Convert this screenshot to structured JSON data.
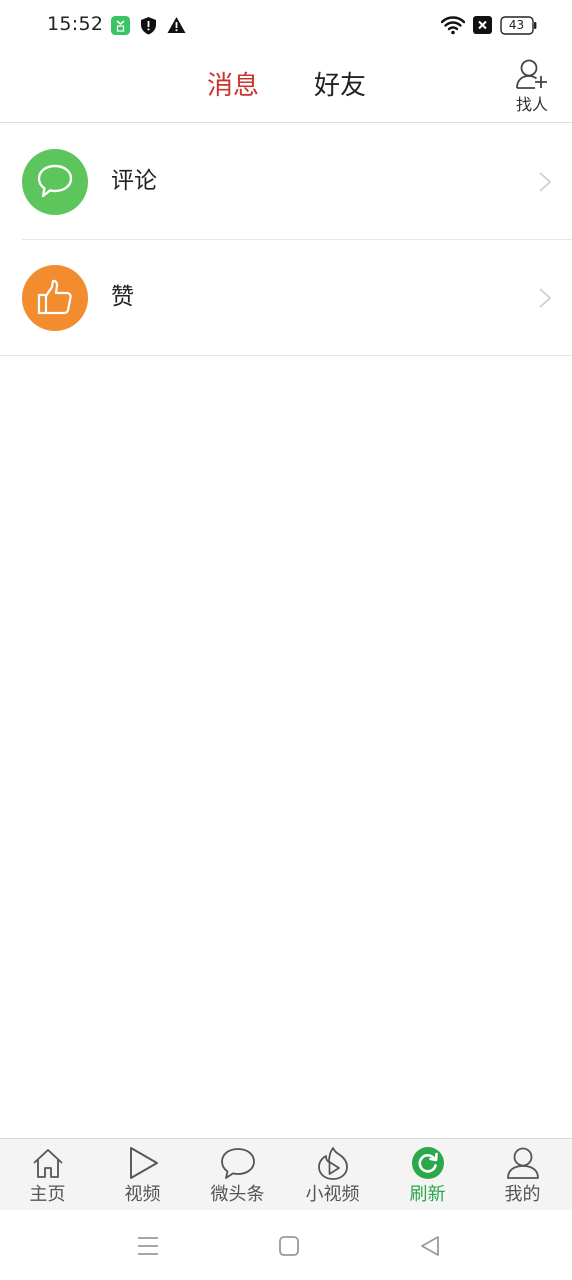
{
  "status_bar": {
    "time": "15:52",
    "battery_level": "43",
    "icons": [
      "app-notification-icon",
      "shield-icon",
      "warning-icon",
      "wifi-icon",
      "x-box-icon",
      "battery-icon"
    ]
  },
  "header": {
    "tabs": [
      {
        "label": "消息",
        "active": true
      },
      {
        "label": "好友",
        "active": false
      }
    ],
    "find_people_label": "找人"
  },
  "list": {
    "items": [
      {
        "label": "评论",
        "icon": "comment-bubble-icon",
        "color": "#5cc55c"
      },
      {
        "label": "赞",
        "icon": "thumbs-up-icon",
        "color": "#f28c2e"
      }
    ]
  },
  "bottom_nav": {
    "items": [
      {
        "label": "主页",
        "icon": "home-icon",
        "active": false
      },
      {
        "label": "视频",
        "icon": "play-icon",
        "active": false
      },
      {
        "label": "微头条",
        "icon": "speech-bubble-icon",
        "active": false
      },
      {
        "label": "小视频",
        "icon": "flame-play-icon",
        "active": false
      },
      {
        "label": "刷新",
        "icon": "refresh-icon",
        "active": true
      },
      {
        "label": "我的",
        "icon": "user-icon",
        "active": false
      }
    ]
  },
  "colors": {
    "active_tab": "#c8342f",
    "active_nav": "#2aa84a",
    "comment_green": "#5cc55c",
    "like_orange": "#f28c2e"
  }
}
